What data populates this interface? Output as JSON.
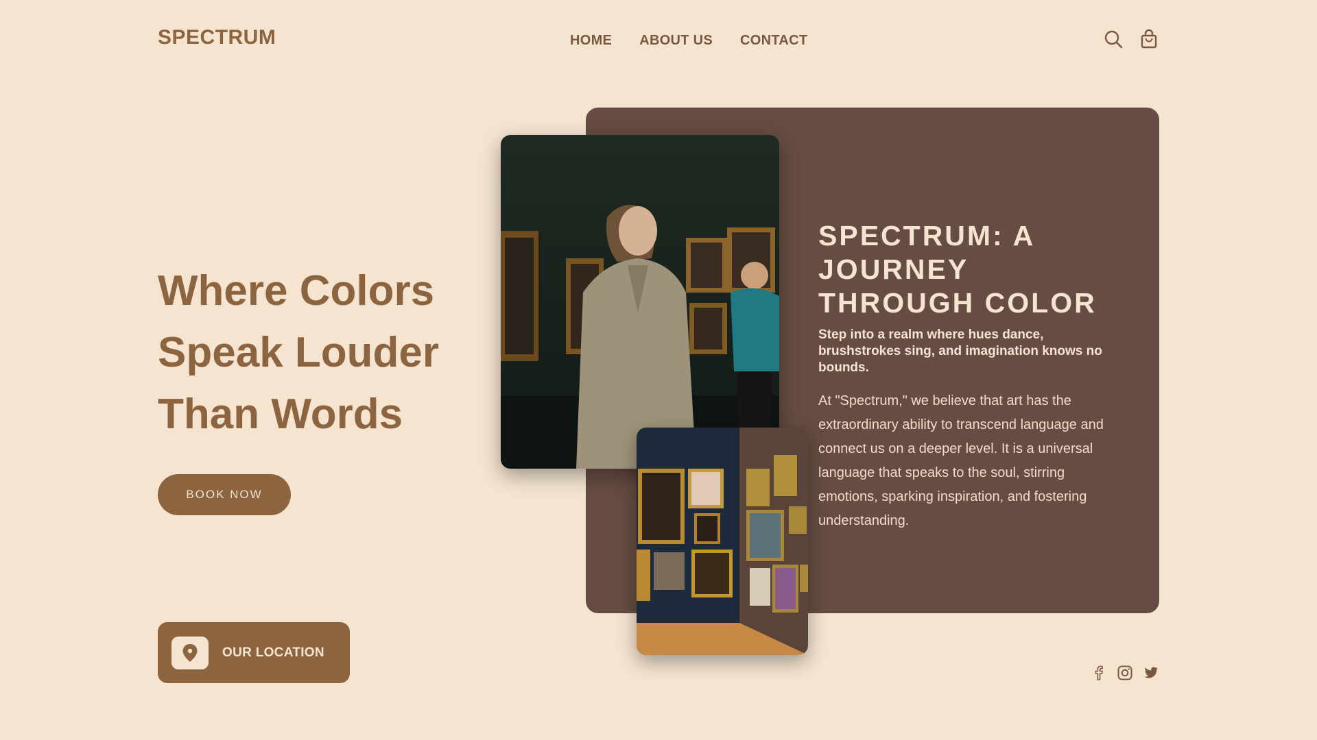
{
  "brand": {
    "name": "SPECTRUM"
  },
  "nav": {
    "items": [
      {
        "label": "HOME"
      },
      {
        "label": "ABOUT US"
      },
      {
        "label": "CONTACT"
      }
    ]
  },
  "header_icons": [
    "search-icon",
    "shopping-bag-icon"
  ],
  "hero": {
    "title_lines": [
      "Where Colors",
      "Speak Louder",
      "Than Words"
    ],
    "cta_label": "BOOK NOW"
  },
  "location": {
    "label": "OUR LOCATION",
    "icon": "location-pin-icon"
  },
  "feature": {
    "title": "SPECTRUM: A JOURNEY THROUGH COLOR",
    "subtitle": "Step into a realm where hues dance, brushstrokes sing, and imagination knows no bounds.",
    "body": "At \"Spectrum,\" we believe that art has the extraordinary ability to transcend language and connect us on a deeper level. It is a universal language that speaks to the soul, stirring emotions, sparking inspiration, and fostering understanding."
  },
  "social": [
    "facebook-icon",
    "instagram-icon",
    "twitter-icon"
  ],
  "colors": {
    "background": "#f5e4d0",
    "accent": "#8c6440",
    "card": "#664c42",
    "card_text": "#f5e4d0"
  }
}
